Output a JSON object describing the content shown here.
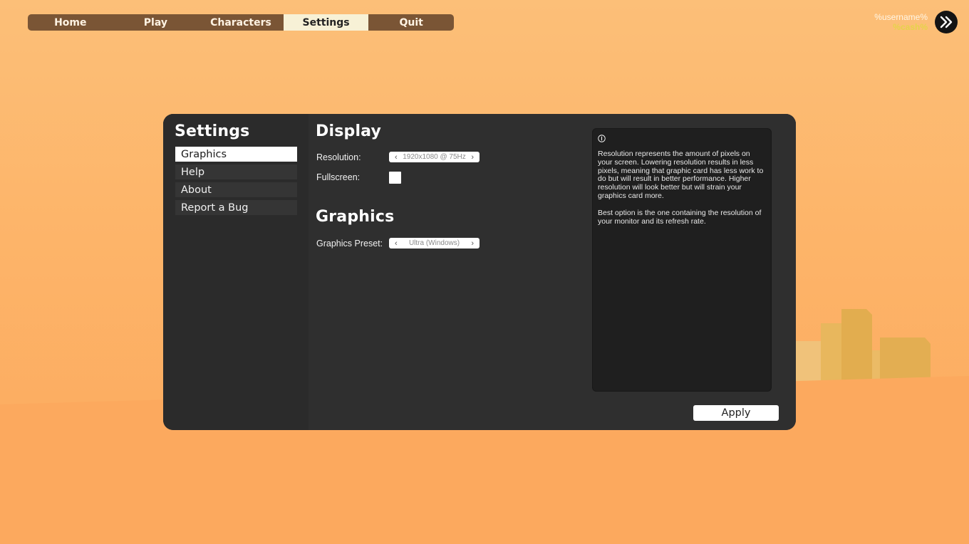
{
  "nav": {
    "tabs": [
      {
        "label": "Home"
      },
      {
        "label": "Play"
      },
      {
        "label": "Characters"
      },
      {
        "label": "Settings",
        "active": true
      },
      {
        "label": "Quit"
      }
    ]
  },
  "user": {
    "username": "%username%",
    "cash": "%cash%"
  },
  "skip_icon": "double-chevron-right-icon",
  "sidebar": {
    "title": "Settings",
    "items": [
      {
        "label": "Graphics",
        "active": true
      },
      {
        "label": "Help"
      },
      {
        "label": "About"
      },
      {
        "label": "Report a Bug"
      }
    ]
  },
  "display": {
    "title": "Display",
    "resolution_label": "Resolution:",
    "resolution_value": "1920x1080 @ 75Hz",
    "fullscreen_label": "Fullscreen:",
    "fullscreen_checked": false
  },
  "graphics": {
    "title": "Graphics",
    "preset_label": "Graphics Preset:",
    "preset_value": "Ultra (Windows)"
  },
  "info": {
    "icon": "info-icon",
    "paragraphs": [
      "Resolution represents the amount of pixels on your screen. Lowering resolution results in less pixels, meaning that graphic card has less work to do but will result in better performance. Higher resolution will look better but will strain your graphics card more.",
      "Best option is the one containing the resolution of your monitor and its refresh rate."
    ]
  },
  "apply_label": "Apply",
  "colors": {
    "sky": "#fcbf78",
    "ground": "#fca85c",
    "nav_bg": "#7a5535",
    "nav_active": "#f7f1d6",
    "panel": "#2e2e2e",
    "cash": "#e6d34a"
  }
}
